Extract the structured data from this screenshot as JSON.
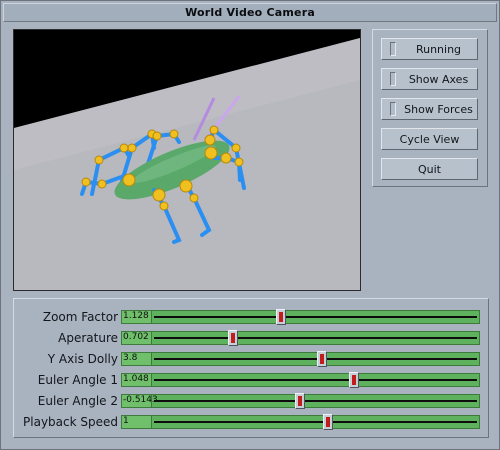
{
  "window": {
    "title": "World Video Camera"
  },
  "buttons": {
    "running": "Running",
    "show_axes": "Show Axes",
    "show_forces": "Show Forces",
    "cycle_view": "Cycle View",
    "quit": "Quit"
  },
  "sliders": [
    {
      "label": "Zoom Factor",
      "value": "1.128",
      "fraction": 0.39
    },
    {
      "label": "Aperature",
      "value": "0.702",
      "fraction": 0.24
    },
    {
      "label": "Y Axis Dolly",
      "value": "3.8",
      "fraction": 0.52
    },
    {
      "label": "Euler Angle 1",
      "value": "1.048",
      "fraction": 0.62
    },
    {
      "label": "Euler Angle 2",
      "value": "-0.5143",
      "fraction": 0.45
    },
    {
      "label": "Playback Speed",
      "value": "1",
      "fraction": 0.54
    }
  ],
  "colors": {
    "slider_green": "#5fb25d",
    "thumb_red": "#c21d1d",
    "body_green": "#5aa86a",
    "joint_yellow": "#f0c020",
    "leg_blue": "#2a8ff0",
    "antenna_violet": "#b58be0"
  }
}
